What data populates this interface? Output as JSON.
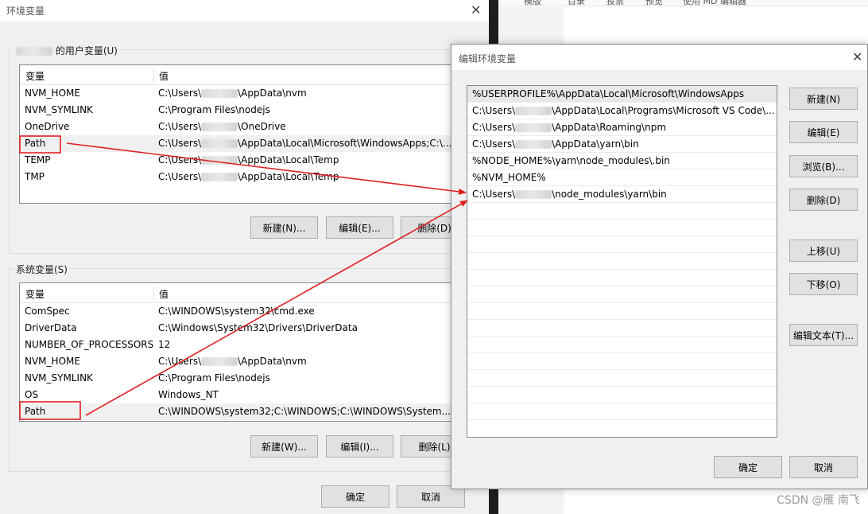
{
  "background_editor": {
    "toolbar_items": [
      "模版",
      "目录",
      "投票",
      "预览",
      "使用 MD 编辑器"
    ]
  },
  "main_dialog": {
    "title": "环境变量",
    "close_glyph": "✕",
    "user_group": {
      "label_suffix": "的用户变量(U)",
      "col_var": "变量",
      "col_val": "值",
      "rows": [
        {
          "name": "NVM_HOME",
          "pre": "C:\\Users\\",
          "post": "\\AppData\\nvm"
        },
        {
          "name": "NVM_SYMLINK",
          "pre": "C:\\Program Files\\nodejs",
          "post": ""
        },
        {
          "name": "OneDrive",
          "pre": "C:\\Users\\",
          "post": "\\OneDrive"
        },
        {
          "name": "Path",
          "pre": "C:\\Users\\",
          "post": "\\AppData\\Local\\Microsoft\\WindowsApps;C:\\..."
        },
        {
          "name": "TEMP",
          "pre": "C:\\Users\\",
          "post": "\\AppData\\Local\\Temp"
        },
        {
          "name": "TMP",
          "pre": "C:\\Users\\",
          "post": "\\AppData\\Local\\Temp"
        }
      ],
      "buttons": {
        "new": "新建(N)...",
        "edit": "编辑(E)...",
        "delete": "删除(D)"
      }
    },
    "system_group": {
      "label": "系统变量(S)",
      "col_var": "变量",
      "col_val": "值",
      "rows": [
        {
          "name": "ComSpec",
          "pre": "C:\\WINDOWS\\system32\\cmd.exe",
          "post": ""
        },
        {
          "name": "DriverData",
          "pre": "C:\\Windows\\System32\\Drivers\\DriverData",
          "post": ""
        },
        {
          "name": "NUMBER_OF_PROCESSORS",
          "pre": "12",
          "post": ""
        },
        {
          "name": "NVM_HOME",
          "pre": "C:\\Users\\",
          "post": "\\AppData\\nvm"
        },
        {
          "name": "NVM_SYMLINK",
          "pre": "C:\\Program Files\\nodejs",
          "post": ""
        },
        {
          "name": "OS",
          "pre": "Windows_NT",
          "post": ""
        },
        {
          "name": "Path",
          "pre": "C:\\WINDOWS\\system32;C:\\WINDOWS;C:\\WINDOWS\\System...",
          "post": ""
        }
      ],
      "buttons": {
        "new": "新建(W)...",
        "edit": "编辑(I)...",
        "delete": "删除(L)"
      }
    },
    "ok": "确定",
    "cancel": "取消"
  },
  "edit_dialog": {
    "title": "编辑环境变量",
    "close_glyph": "✕",
    "entries": [
      {
        "pre": "%USERPROFILE%\\AppData\\Local\\Microsoft\\WindowsApps",
        "post": ""
      },
      {
        "pre": "C:\\Users\\",
        "post": "\\AppData\\Local\\Programs\\Microsoft VS Code\\..."
      },
      {
        "pre": "C:\\Users\\",
        "post": "\\AppData\\Roaming\\npm"
      },
      {
        "pre": "C:\\Users\\",
        "post": "\\AppData\\yarn\\bin"
      },
      {
        "pre": "%NODE_HOME%\\yarn\\node_modules\\.bin",
        "post": ""
      },
      {
        "pre": "%NVM_HOME%",
        "post": ""
      },
      {
        "pre": "C:\\Users\\",
        "post": "\\node_modules\\yarn\\bin"
      }
    ],
    "buttons": {
      "new": "新建(N)",
      "edit": "编辑(E)",
      "browse": "浏览(B)...",
      "delete": "删除(D)",
      "up": "上移(U)",
      "down": "下移(O)",
      "edit_text": "编辑文本(T)...",
      "ok": "确定",
      "cancel": "取消"
    }
  },
  "watermark": "CSDN @雁 南飞",
  "colors": {
    "annotation_red": "#e02020",
    "selection": "#e8e8e8"
  }
}
